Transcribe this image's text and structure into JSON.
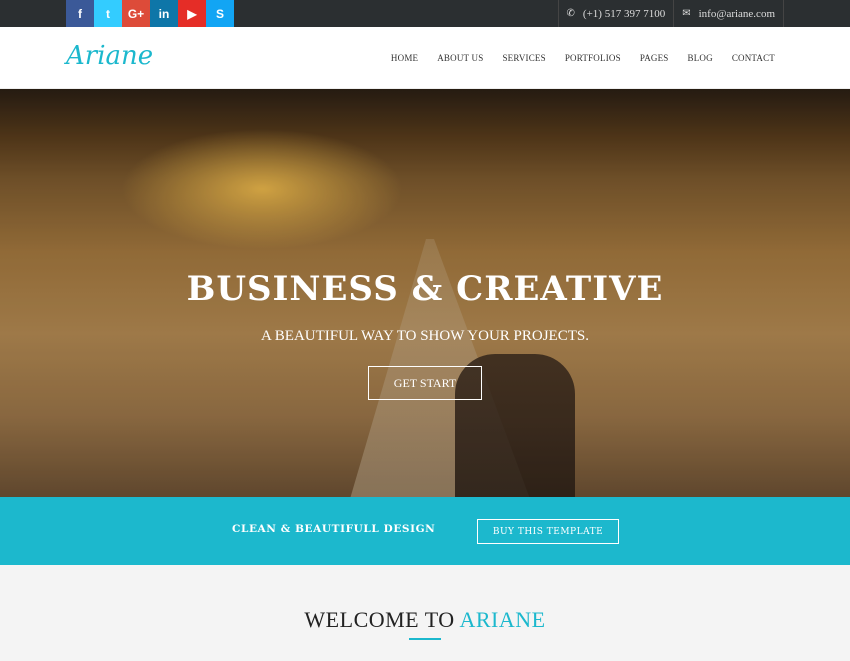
{
  "social": [
    {
      "name": "facebook",
      "glyph": "f",
      "color": "#3b5998"
    },
    {
      "name": "twitter",
      "glyph": "t",
      "color": "#33ccff"
    },
    {
      "name": "google-plus",
      "glyph": "G+",
      "color": "#dd4b39"
    },
    {
      "name": "linkedin",
      "glyph": "in",
      "color": "#0e76a8"
    },
    {
      "name": "youtube",
      "glyph": "▶",
      "color": "#e52d27"
    },
    {
      "name": "skype",
      "glyph": "S",
      "color": "#12a5f4"
    }
  ],
  "contact": {
    "phone": "(+1) 517 397 7100",
    "email": "info@ariane.com"
  },
  "brand": {
    "logo": "Ariane",
    "accent": "#1cb8cd"
  },
  "menu": [
    "HOME",
    "ABOUT US",
    "SERVICES",
    "PORTFOLIOS",
    "PAGES",
    "BLOG",
    "CONTACT"
  ],
  "hero": {
    "title": "BUSINESS & CREATIVE",
    "subtitle": "A BEAUTIFUL WAY TO SHOW YOUR PROJECTS.",
    "button": "GET START"
  },
  "band": {
    "text": "CLEAN & BEAUTIFULL DESIGN",
    "button": "BUY THIS TEMPLATE"
  },
  "welcome": {
    "prefix": "WELCOME TO ",
    "accent": "ARIANE"
  }
}
